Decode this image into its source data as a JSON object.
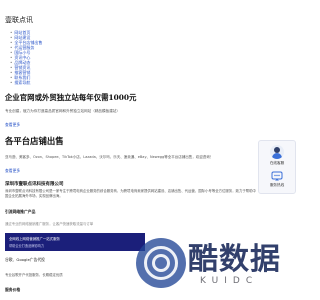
{
  "site": {
    "brand": "壹联点讯"
  },
  "nav": {
    "items": [
      {
        "label": "网站首页"
      },
      {
        "label": "网站建设"
      },
      {
        "label": "全平台店铺出售"
      },
      {
        "label": "代运营服务"
      },
      {
        "label": "国际小号"
      },
      {
        "label": "资讯中心"
      },
      {
        "label": "品牌动态"
      },
      {
        "label": "营销资讯"
      },
      {
        "label": "推客营销"
      },
      {
        "label": "联系我们"
      },
      {
        "label": "搜索导航"
      }
    ]
  },
  "article1": {
    "title": "企业官网或外贸独立站每年仅需1000元",
    "intro": "专业创建，赋力为你打造高品质官网和外贸独立站网站（精品模板建站）",
    "more": "查看更多"
  },
  "article2": {
    "title": "各平台店铺出售",
    "platforms": "亚马逊、美客多、Ozon、Shopee、TikTok小店、Lazada、沃尔玛、乐天、速卖通、eBay、Newegg等全平台店铺出售，欢迎咨询！",
    "more": "查看更多"
  },
  "company": {
    "name": "深圳市壹联点讯科技有限公司",
    "desc": "深圳市壹联点讯科技有限公司是一家专注于跨境电商企业服务的综合服务商，为跨境电商卖家提供网站建设、店铺出售、代运营、国际小号等全方位服务，致力于帮助中国企业拓展海外市场，实现品牌出海。"
  },
  "section": {
    "title": "引流网络推广产品",
    "sub": "通过专业的网络营销推广服务，让客户快速获取流量与订单",
    "band_line1": "全网线上网络营销推广一站式服务",
    "band_line2": "帮助企业打造品牌影响力"
  },
  "google": {
    "title": "谷歌、Google广告代投",
    "line": "专业谷歌开户代投服务，长期稳定优质"
  },
  "service": {
    "title": "服务价格"
  },
  "float": {
    "cs_label": "在线客服",
    "svc_label": "服务热线"
  },
  "watermark": {
    "text": "酷数据",
    "sub": "KUIDC"
  },
  "colors": {
    "link": "#2a55c8",
    "band": "#1b1f7a",
    "watermark": "#162658"
  }
}
